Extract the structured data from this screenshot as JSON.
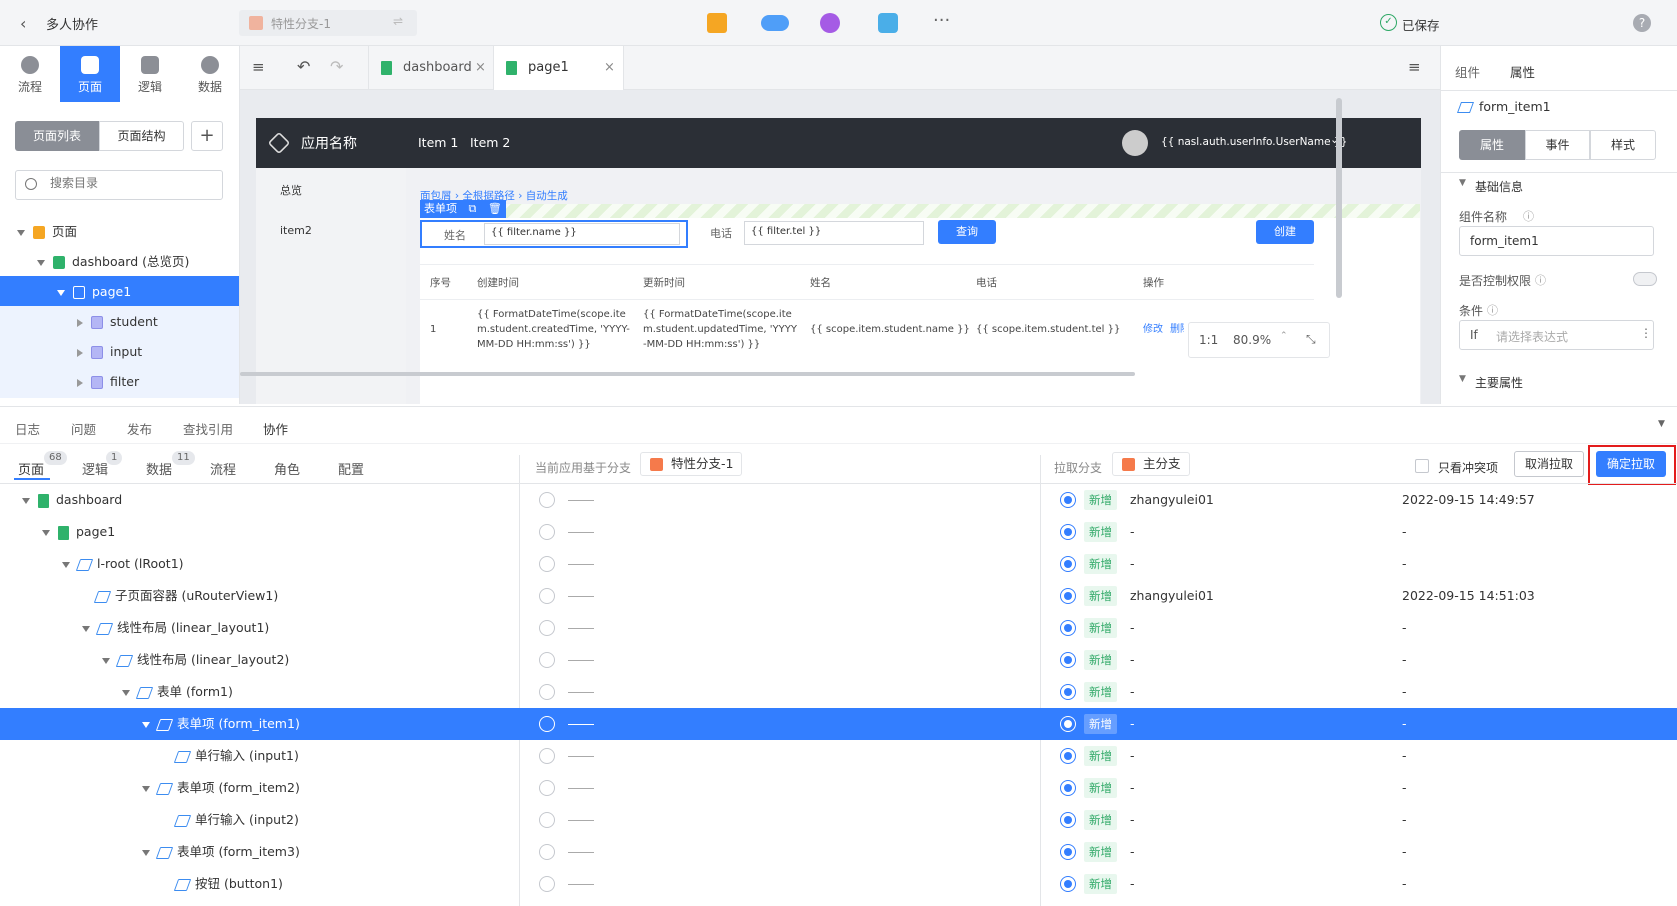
{
  "topbar": {
    "back_label": "多人协作",
    "branch_name": "特性分支-1",
    "saved_label": "已保存",
    "help_icon": "?"
  },
  "sidebar": {
    "nav": [
      {
        "label": "流程",
        "icon": "flow-icon"
      },
      {
        "label": "页面",
        "icon": "page-icon"
      },
      {
        "label": "逻辑",
        "icon": "logic-icon"
      },
      {
        "label": "数据",
        "icon": "data-icon"
      }
    ],
    "seg": [
      "页面列表",
      "页面结构"
    ],
    "add_label": "+",
    "search_placeholder": "搜索目录",
    "tree": [
      {
        "label": "页面"
      },
      {
        "label": "dashboard (总览页)"
      },
      {
        "label": "page1"
      },
      {
        "label": "student"
      },
      {
        "label": "input"
      },
      {
        "label": "filter"
      }
    ]
  },
  "editor": {
    "tabs": [
      "dashboard",
      "page1"
    ],
    "close": "×",
    "zoom_ratio": "1:1",
    "zoom": "80.9%"
  },
  "preview": {
    "app_name": "应用名称",
    "nav": [
      "Item 1",
      "Item 2"
    ],
    "user": "{{ nasl.auth.userInfo.UserName }}",
    "side": [
      "总览",
      "item2"
    ],
    "breadcrumb": [
      "面包屑",
      "全根据路径",
      "自动生成"
    ],
    "form_item_tag": "表单项",
    "name_label": "姓名",
    "name_value": "{{ filter.name }}",
    "tel_label": "电话",
    "tel_value": "{{ filter.tel }}",
    "query": "查询",
    "create": "创建",
    "headers": [
      "序号",
      "创建时间",
      "更新时间",
      "姓名",
      "电话",
      "操作"
    ],
    "cells": [
      "1",
      "{{ FormatDateTime(scope.item.student.createdTime, 'YYYY-MM-DD HH:mm:ss') }}",
      "{{ FormatDateTime(scope.item.student.updatedTime, 'YYYY-MM-DD HH:mm:ss') }}",
      "{{ scope.item.student.name }}",
      "{{ scope.item.student.tel }}"
    ],
    "ops": [
      "修改",
      "删除"
    ]
  },
  "rpanel": {
    "tabs": [
      "组件",
      "属性"
    ],
    "component": "form_item1",
    "seg": [
      "属性",
      "事件",
      "样式"
    ],
    "section": "基础信息",
    "name_label": "组件名称",
    "name_value": "form_item1",
    "perm_label": "是否控制权限",
    "cond_label": "条件",
    "cond_prefix": "If",
    "cond_placeholder": "请选择表达式",
    "next_section": "主要属性"
  },
  "bottom": {
    "tabs": [
      "日志",
      "问题",
      "发布",
      "查找引用",
      "协作"
    ],
    "cats": [
      {
        "label": "页面",
        "count": "68"
      },
      {
        "label": "逻辑",
        "count": "1"
      },
      {
        "label": "数据",
        "count": "11"
      },
      {
        "label": "流程",
        "count": ""
      },
      {
        "label": "角色",
        "count": ""
      },
      {
        "label": "配置",
        "count": ""
      }
    ],
    "current_label": "当前应用基于分支",
    "current_branch": "特性分支-1",
    "pull_label": "拉取分支",
    "pull_branch": "主分支",
    "conflict_only": "只看冲突项",
    "cancel": "取消拉取",
    "confirm": "确定拉取",
    "rows": [
      {
        "name": "dashboard",
        "tag": "新增",
        "user": "zhangyulei01",
        "time": "2022-09-15 14:49:57"
      },
      {
        "name": "page1",
        "tag": "新增",
        "user": "-",
        "time": "-"
      },
      {
        "name": "l-root (lRoot1)",
        "tag": "新增",
        "user": "-",
        "time": "-"
      },
      {
        "name": "子页面容器 (uRouterView1)",
        "tag": "新增",
        "user": "zhangyulei01",
        "time": "2022-09-15 14:51:03"
      },
      {
        "name": "线性布局 (linear_layout1)",
        "tag": "新增",
        "user": "-",
        "time": "-"
      },
      {
        "name": "线性布局 (linear_layout2)",
        "tag": "新增",
        "user": "-",
        "time": "-"
      },
      {
        "name": "表单 (form1)",
        "tag": "新增",
        "user": "-",
        "time": "-"
      },
      {
        "name": "表单项 (form_item1)",
        "tag": "新增",
        "user": "-",
        "time": "-"
      },
      {
        "name": "单行输入 (input1)",
        "tag": "新增",
        "user": "-",
        "time": "-"
      },
      {
        "name": "表单项 (form_item2)",
        "tag": "新增",
        "user": "-",
        "time": "-"
      },
      {
        "name": "单行输入 (input2)",
        "tag": "新增",
        "user": "-",
        "time": "-"
      },
      {
        "name": "表单项 (form_item3)",
        "tag": "新增",
        "user": "-",
        "time": "-"
      },
      {
        "name": "按钮 (button1)",
        "tag": "新增",
        "user": "-",
        "time": "-"
      }
    ]
  }
}
